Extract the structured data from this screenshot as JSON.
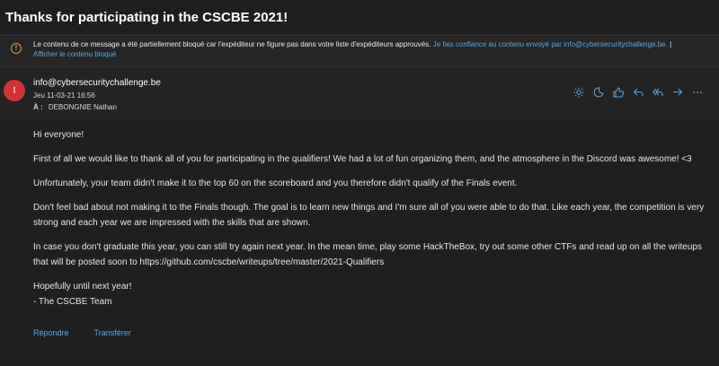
{
  "subject": "Thanks for participating in the CSCBE 2021!",
  "warning": {
    "icon": "info-circle-icon",
    "text": "Le contenu de ce message a été partiellement bloqué car l'expéditeur ne figure pas dans votre liste d'expéditeurs approuvés.",
    "trust_link": "Je fais confiance au contenu envoyé par info@cybersecuritychallenge.be.",
    "separator": "|",
    "show_link": "Afficher le contenu bloqué"
  },
  "message": {
    "avatar_initial": "I",
    "avatar_color": "#d13438",
    "sender": "info@cybersecuritychallenge.be",
    "date": "Jeu 11-03-21 16:56",
    "to_label": "À :",
    "to_value": "DEBONGNIE Nathan"
  },
  "actions": [
    {
      "icon": "sun-icon"
    },
    {
      "icon": "moon-icon"
    },
    {
      "icon": "thumbs-up-icon"
    },
    {
      "icon": "reply-icon"
    },
    {
      "icon": "reply-all-icon"
    },
    {
      "icon": "forward-icon"
    },
    {
      "icon": "more-icon"
    }
  ],
  "body": {
    "greeting": "Hi everyone!",
    "p1": "First of all we would like to thank all of you for participating in the qualifiers! We had a lot of fun organizing them, and the atmosphere in the Discord was awesome! <3",
    "p2": "Unfortunately, your team didn't make it to the top 60 on the scoreboard and you therefore didn't qualify of the Finals event.",
    "p3": "Don't feel bad about not making it to the Finals though. The goal is to learn new things and I'm sure all of you were able to do that. Like each year, the competition is very strong and each year we are impressed with the skills that are shown.",
    "p4": "In case you don't graduate this year, you can still try again next year. In the mean time, play some HackTheBox, try out some other CTFs and read up on all the writeups that will be posted soon to https://github.com/cscbe/writeups/tree/master/2021-Qualifiers",
    "sign1": "Hopefully until next year!",
    "sign2": "- The CSCBE Team"
  },
  "footer": {
    "reply": "Répondre",
    "forward": "Transférer"
  }
}
